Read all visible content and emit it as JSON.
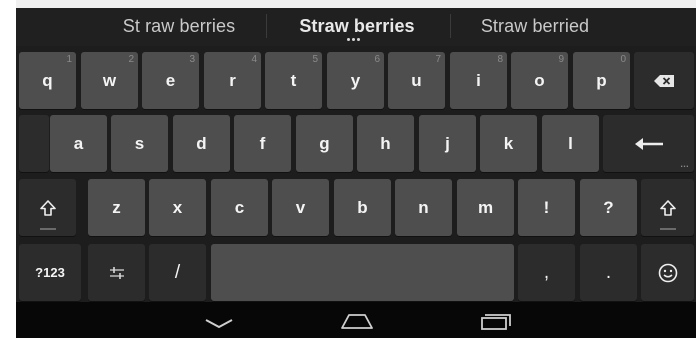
{
  "suggestions": {
    "left": "St raw berries",
    "center": "Straw berries",
    "right": "Straw berried"
  },
  "keyboard": {
    "row1": [
      {
        "label": "q",
        "hint": "1"
      },
      {
        "label": "w",
        "hint": "2"
      },
      {
        "label": "e",
        "hint": "3"
      },
      {
        "label": "r",
        "hint": "4"
      },
      {
        "label": "t",
        "hint": "5"
      },
      {
        "label": "y",
        "hint": "6"
      },
      {
        "label": "u",
        "hint": "7"
      },
      {
        "label": "i",
        "hint": "8"
      },
      {
        "label": "o",
        "hint": "9"
      },
      {
        "label": "p",
        "hint": "0"
      }
    ],
    "row2": [
      "a",
      "s",
      "d",
      "f",
      "g",
      "h",
      "j",
      "k",
      "l"
    ],
    "row3": [
      "z",
      "x",
      "c",
      "v",
      "b",
      "n",
      "m",
      "!",
      "?"
    ],
    "row4": {
      "symbols": "?123",
      "slash": "/",
      "comma": ",",
      "period": "."
    },
    "icons": {
      "backspace": "backspace-icon",
      "enter": "enter-arrow-icon",
      "shift": "shift-arrow-icon",
      "settings": "settings-sliders-icon",
      "emoji": "smiley-icon",
      "back": "nav-back-icon",
      "home": "nav-home-icon",
      "recents": "nav-recents-icon"
    }
  },
  "colors": {
    "panel": "#1d1d1d",
    "key": "#4e4e4e",
    "function_key": "#2c2c2c",
    "key_text": "#f4f4f4",
    "nav_bar": "#070707"
  }
}
